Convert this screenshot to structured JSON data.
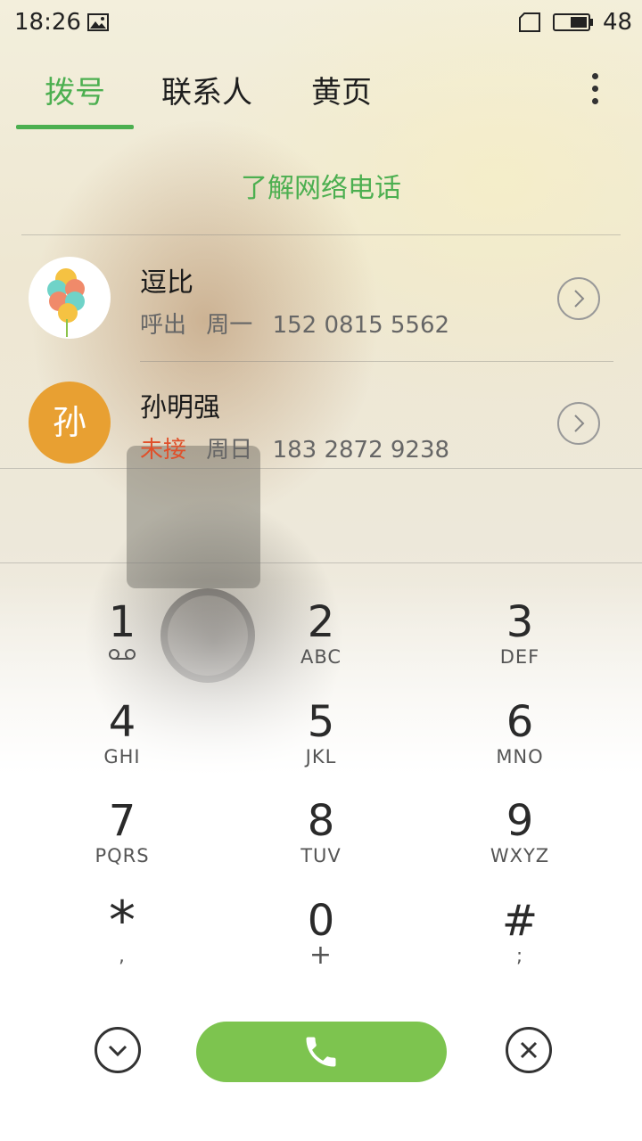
{
  "status_bar": {
    "time": "18:26",
    "battery": "48"
  },
  "tabs": [
    {
      "label": "拨号",
      "active": true
    },
    {
      "label": "联系人",
      "active": false
    },
    {
      "label": "黄页",
      "active": false
    }
  ],
  "promo_link": "了解网络电话",
  "call_log": [
    {
      "name": "逗比",
      "type": "呼出",
      "day": "周一",
      "number": "152 0815 5562",
      "avatar": "balloons"
    },
    {
      "name": "孙明强",
      "avatar_letter": "孙",
      "type": "未接",
      "day": "周日",
      "number": "183 2872 9238",
      "missed": true
    }
  ],
  "keypad": [
    {
      "digit": "1",
      "letters": ""
    },
    {
      "digit": "2",
      "letters": "ABC"
    },
    {
      "digit": "3",
      "letters": "DEF"
    },
    {
      "digit": "4",
      "letters": "GHI"
    },
    {
      "digit": "5",
      "letters": "JKL"
    },
    {
      "digit": "6",
      "letters": "MNO"
    },
    {
      "digit": "7",
      "letters": "PQRS"
    },
    {
      "digit": "8",
      "letters": "TUV"
    },
    {
      "digit": "9",
      "letters": "WXYZ"
    },
    {
      "digit": "*",
      "letters": ","
    },
    {
      "digit": "0",
      "letters": "+"
    },
    {
      "digit": "#",
      "letters": ";"
    }
  ],
  "colors": {
    "accent": "#4caf50",
    "call_button": "#7dc44f",
    "missed": "#e0502a",
    "avatar_orange": "#e8a032"
  },
  "icons": [
    "gallery-icon",
    "sim-icon",
    "battery-icon",
    "more-icon",
    "chevron-right-icon",
    "voicemail-icon",
    "chevron-down-icon",
    "phone-icon",
    "delete-icon"
  ]
}
